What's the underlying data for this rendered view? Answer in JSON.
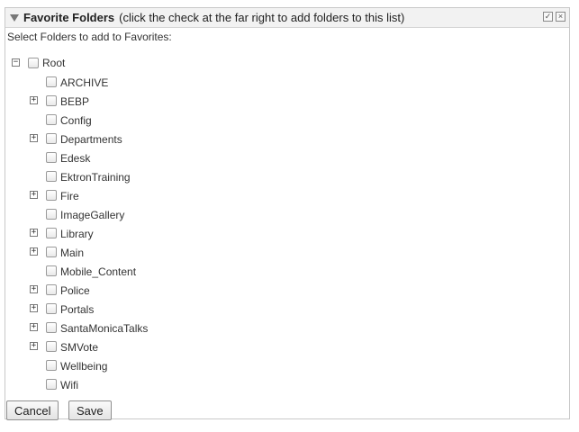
{
  "panel": {
    "title": "Favorite Folders",
    "subtitle": "(click the check at the far right to add folders to this list)",
    "check_icon": "✓",
    "close_icon": "×"
  },
  "instruction": "Select Folders to add to Favorites:",
  "tree": {
    "root": {
      "label": "Root",
      "expander": "−",
      "checked": false
    },
    "children": [
      {
        "label": "ARCHIVE",
        "expandable": false,
        "checked": false
      },
      {
        "label": "BEBP",
        "expandable": true,
        "checked": false
      },
      {
        "label": "Config",
        "expandable": false,
        "checked": false
      },
      {
        "label": "Departments",
        "expandable": true,
        "checked": false
      },
      {
        "label": "Edesk",
        "expandable": false,
        "checked": false
      },
      {
        "label": "EktronTraining",
        "expandable": false,
        "checked": false
      },
      {
        "label": "Fire",
        "expandable": true,
        "checked": false
      },
      {
        "label": "ImageGallery",
        "expandable": false,
        "checked": false
      },
      {
        "label": "Library",
        "expandable": true,
        "checked": false
      },
      {
        "label": "Main",
        "expandable": true,
        "checked": false
      },
      {
        "label": "Mobile_Content",
        "expandable": false,
        "checked": false
      },
      {
        "label": "Police",
        "expandable": true,
        "checked": false
      },
      {
        "label": "Portals",
        "expandable": true,
        "checked": false
      },
      {
        "label": "SantaMonicaTalks",
        "expandable": true,
        "checked": false
      },
      {
        "label": "SMVote",
        "expandable": true,
        "checked": false
      },
      {
        "label": "Wellbeing",
        "expandable": false,
        "checked": false
      },
      {
        "label": "Wifi",
        "expandable": false,
        "checked": false
      }
    ],
    "expand_glyph": "+"
  },
  "buttons": {
    "cancel": "Cancel",
    "save": "Save"
  }
}
